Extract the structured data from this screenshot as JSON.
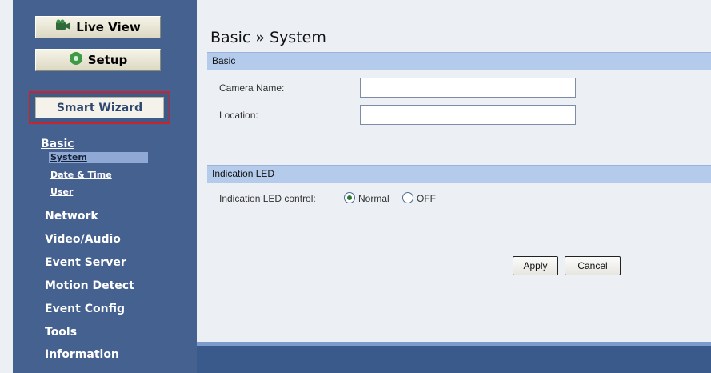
{
  "sidebar": {
    "live_view": "Live View",
    "setup": "Setup",
    "smart_wizard": "Smart Wizard",
    "basic": "Basic",
    "basic_items": [
      "System",
      "Date & Time",
      "User"
    ],
    "nav": [
      "Network",
      "Video/Audio",
      "Event Server",
      "Motion Detect",
      "Event Config",
      "Tools",
      "Information"
    ]
  },
  "main": {
    "title": "Basic » System",
    "basic_section": {
      "header": "Basic",
      "camera_name_label": "Camera Name:",
      "camera_name_value": "",
      "location_label": "Location:",
      "location_value": ""
    },
    "led_section": {
      "header": "Indication LED",
      "control_label": "Indication LED control:",
      "options": [
        "Normal",
        "OFF"
      ],
      "selected": "Normal"
    },
    "buttons": {
      "apply": "Apply",
      "cancel": "Cancel"
    }
  },
  "colors": {
    "sidebar": "#45618f",
    "section_bar": "#b5cbec",
    "selected_sub": "#90a9d4",
    "wizard_border": "#c9242e"
  }
}
